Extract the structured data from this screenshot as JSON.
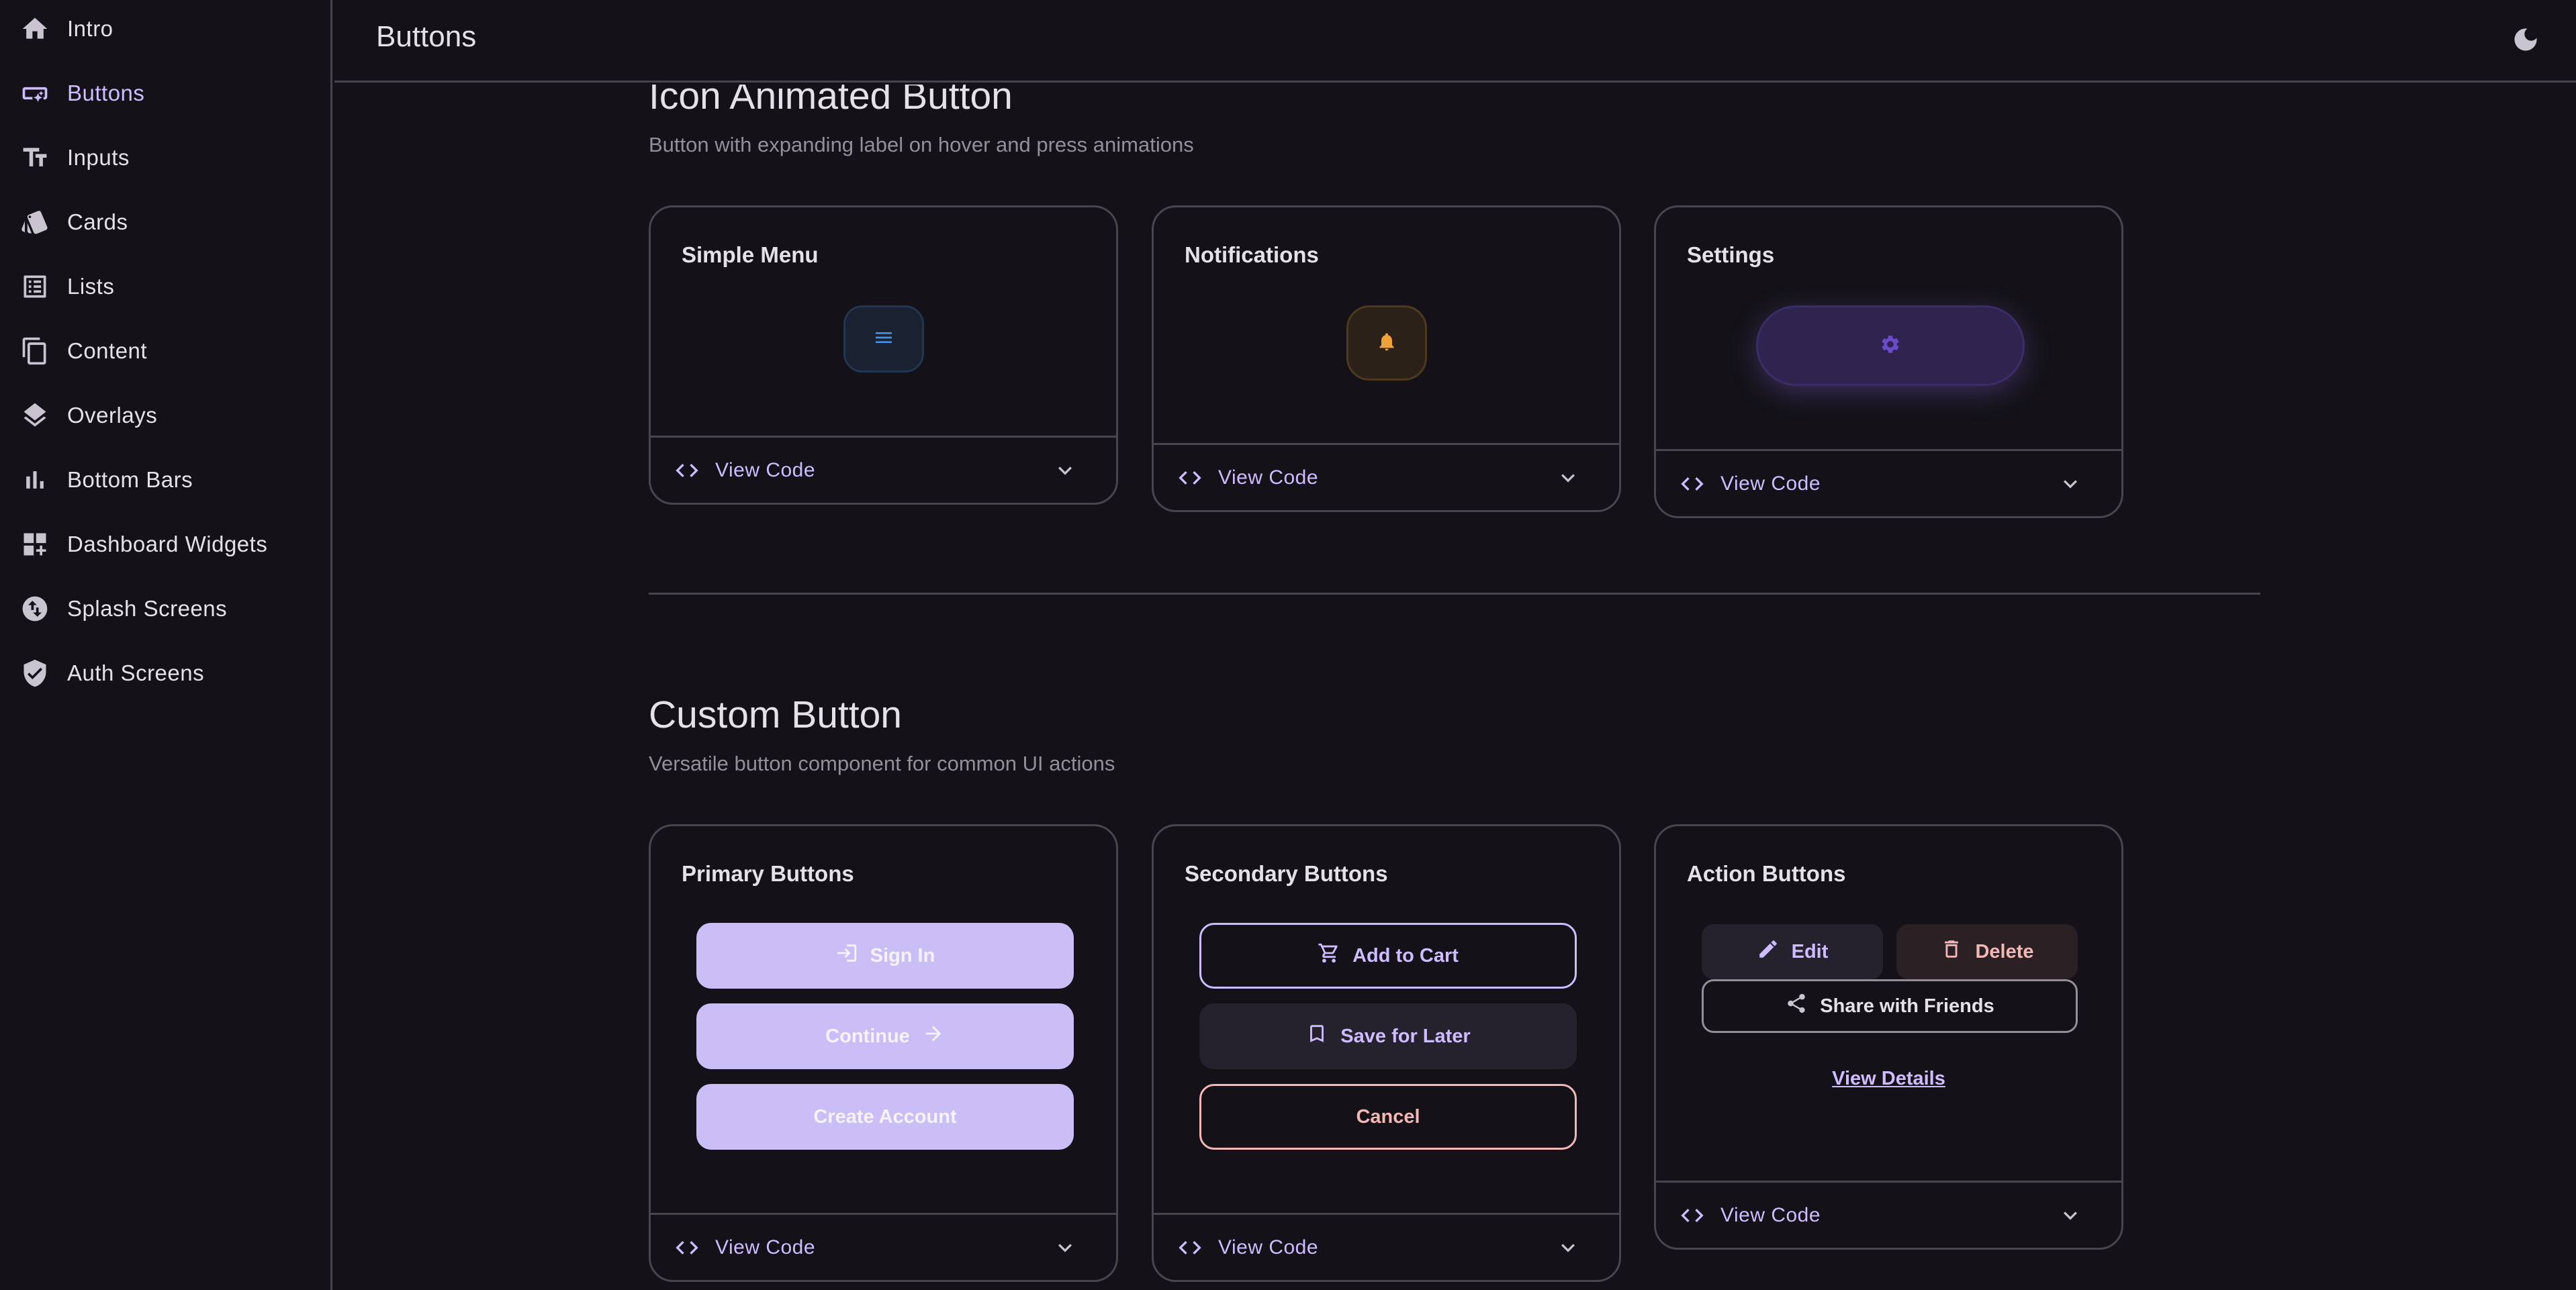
{
  "sidebar": {
    "items": [
      {
        "label": "Intro",
        "icon": "home-icon",
        "active": false
      },
      {
        "label": "Buttons",
        "icon": "smart-button-icon",
        "active": true
      },
      {
        "label": "Inputs",
        "icon": "text-fields-icon",
        "active": false
      },
      {
        "label": "Cards",
        "icon": "cards-icon",
        "active": false
      },
      {
        "label": "Lists",
        "icon": "list-icon",
        "active": false
      },
      {
        "label": "Content",
        "icon": "copy-icon",
        "active": false
      },
      {
        "label": "Overlays",
        "icon": "layers-icon",
        "active": false
      },
      {
        "label": "Bottom Bars",
        "icon": "bar-chart-icon",
        "active": false
      },
      {
        "label": "Dashboard Widgets",
        "icon": "dashboard-add-icon",
        "active": false
      },
      {
        "label": "Splash Screens",
        "icon": "swap-vertical-icon",
        "active": false
      },
      {
        "label": "Auth Screens",
        "icon": "verified-shield-icon",
        "active": false
      }
    ]
  },
  "header": {
    "title": "Buttons",
    "theme_toggle_icon": "moon-icon"
  },
  "sections": [
    {
      "title": "Icon Animated Button",
      "subtitle": "Button with expanding label on hover and press animations",
      "cards": [
        {
          "title": "Simple Menu",
          "button_icon": "menu-icon",
          "footer_label": "View Code"
        },
        {
          "title": "Notifications",
          "button_icon": "bell-icon",
          "footer_label": "View Code"
        },
        {
          "title": "Settings",
          "button_icon": "gear-icon",
          "footer_label": "View Code"
        }
      ]
    },
    {
      "title": "Custom Button",
      "subtitle": "Versatile button component for common UI actions",
      "cards": [
        {
          "title": "Primary Buttons",
          "footer_label": "View Code",
          "buttons": [
            {
              "label": "Sign In",
              "icon": "login-icon"
            },
            {
              "label": "Continue",
              "icon": "arrow-right-icon"
            },
            {
              "label": "Create Account"
            }
          ]
        },
        {
          "title": "Secondary Buttons",
          "footer_label": "View Code",
          "buttons": [
            {
              "label": "Add to Cart",
              "icon": "cart-icon"
            },
            {
              "label": "Save for Later",
              "icon": "bookmark-icon"
            },
            {
              "label": "Cancel"
            }
          ]
        },
        {
          "title": "Action Buttons",
          "footer_label": "View Code",
          "buttons": [
            {
              "label": "Edit",
              "icon": "pencil-icon"
            },
            {
              "label": "Delete",
              "icon": "trash-icon"
            },
            {
              "label": "Share with Friends",
              "icon": "share-icon"
            },
            {
              "label": "View Details"
            }
          ]
        }
      ]
    }
  ],
  "colors": {
    "background": "#141218",
    "border": "#49454f",
    "accent": "#cfbcff",
    "primary_button": "#cbbef6",
    "danger": "#f2b8b5",
    "menu_blue": "#4a90e2",
    "bell_orange": "#f0a23a",
    "gear_purple": "#6b4bc9"
  }
}
